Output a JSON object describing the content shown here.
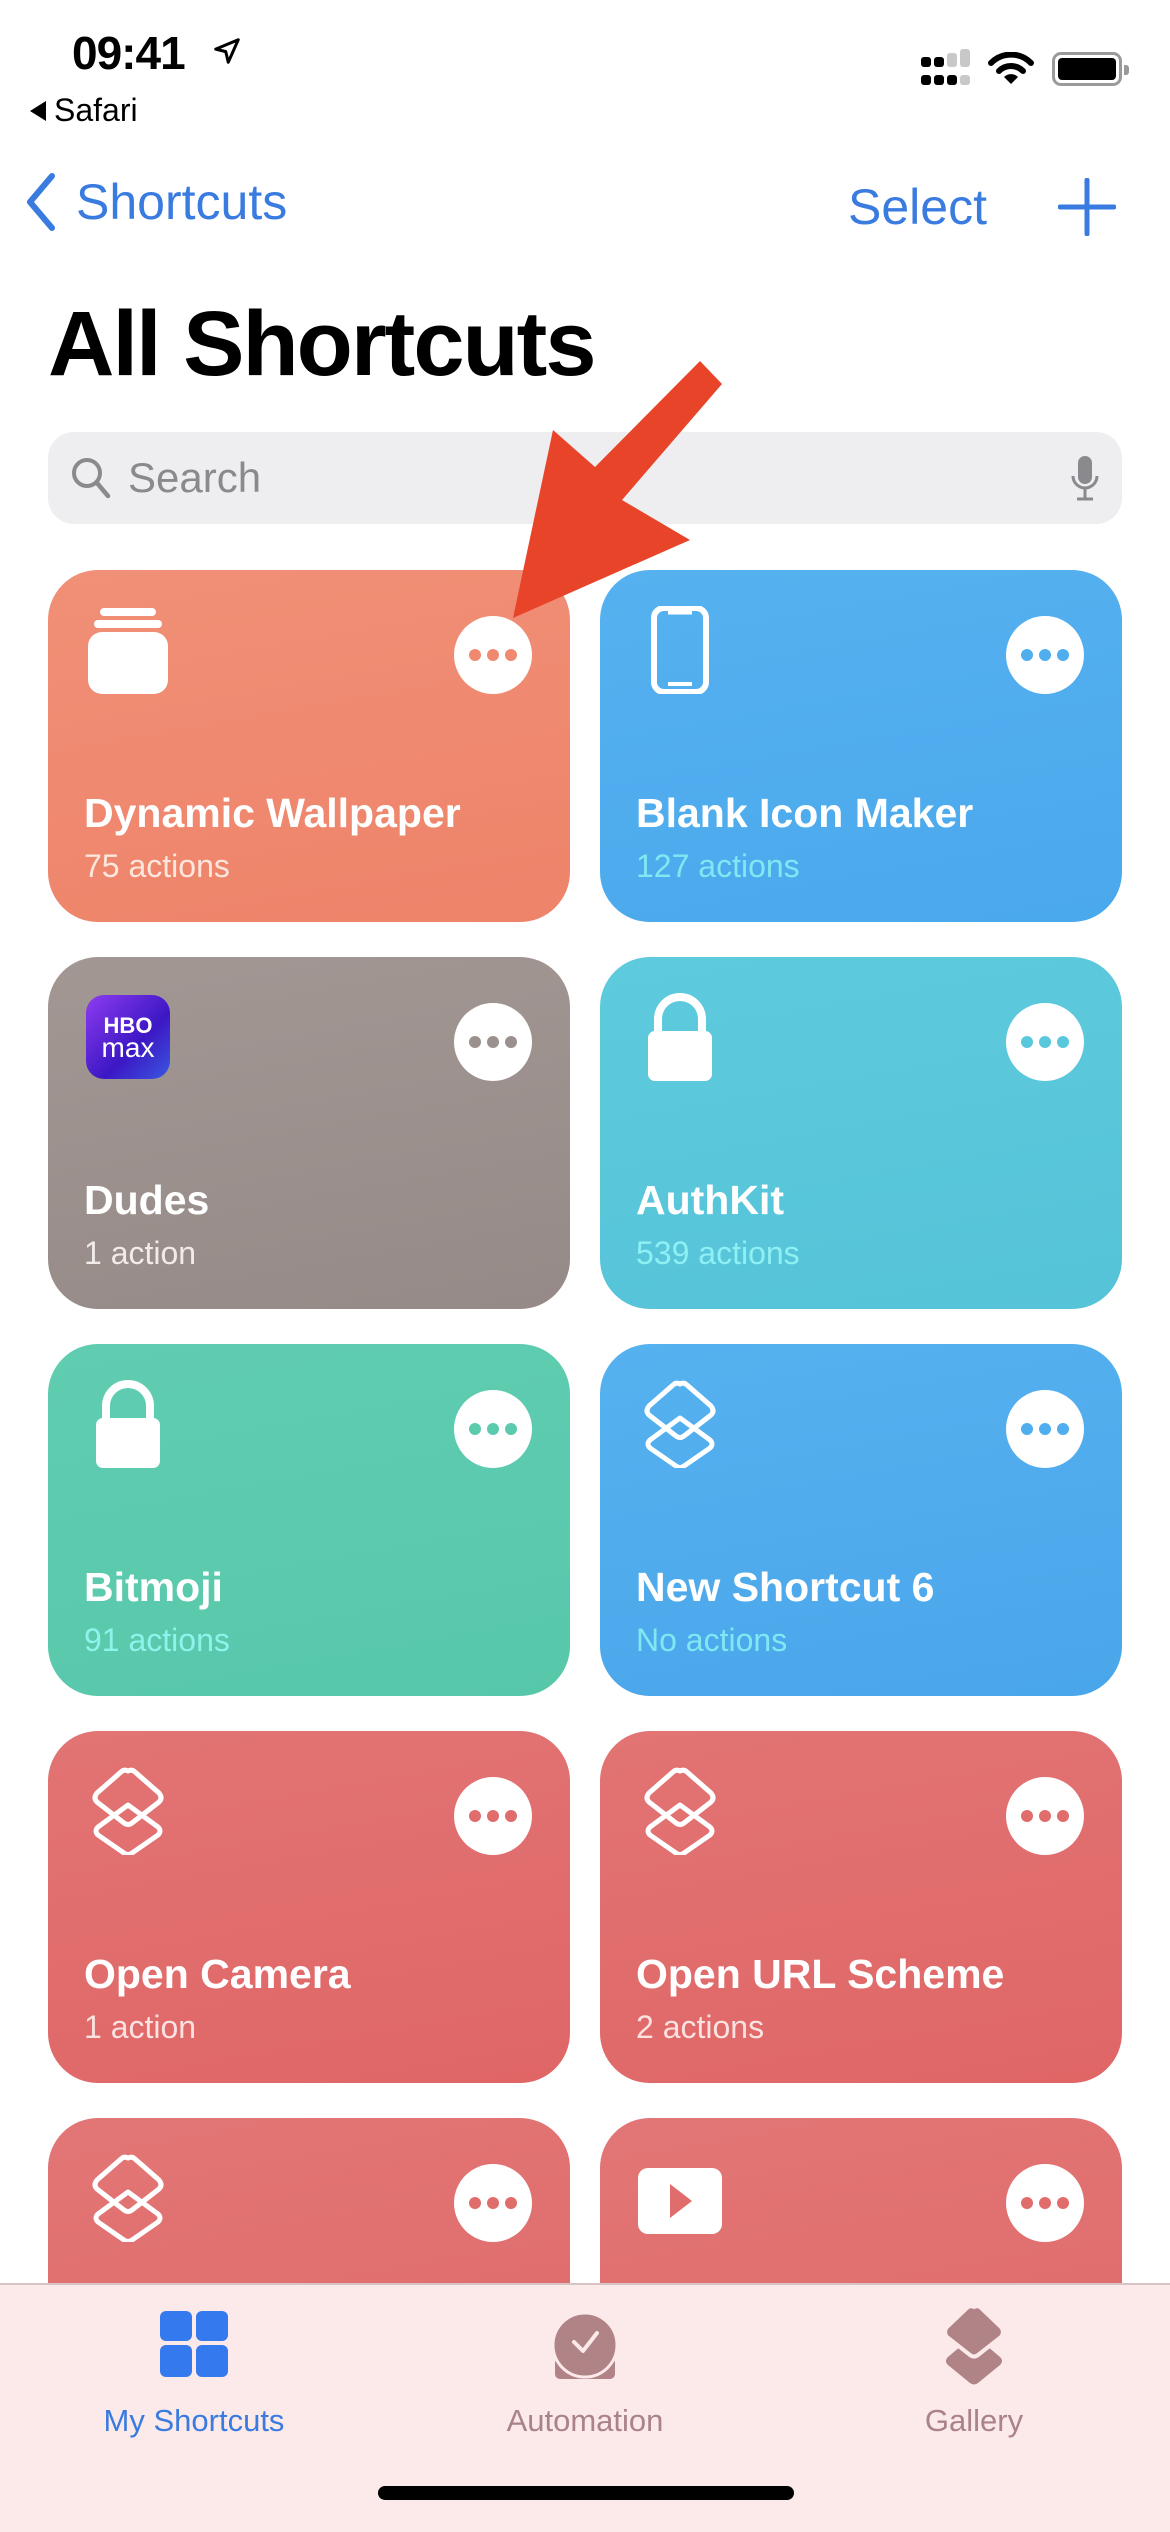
{
  "status_bar": {
    "time": "09:41",
    "back_app": "Safari",
    "icons": [
      "location-arrow-icon",
      "dual-signal-icon",
      "wifi-icon",
      "battery-icon"
    ]
  },
  "nav": {
    "back_label": "Shortcuts",
    "select_label": "Select",
    "add_icon": "plus-icon"
  },
  "page_title": "All Shortcuts",
  "search": {
    "placeholder": "Search",
    "value": ""
  },
  "colors": {
    "accent": "#3a7be0",
    "annotation_arrow": "#e8442a",
    "tab_inactive": "#a98386"
  },
  "shortcuts": [
    {
      "title": "Dynamic Wallpaper",
      "subtitle": "75 actions",
      "icon": "stack-icon",
      "color_top": "#f09077",
      "color_bottom": "#ee8369",
      "dot_color": "#ef8a70",
      "sub_color": "#fde6dc"
    },
    {
      "title": "Blank Icon Maker",
      "subtitle": "127 actions",
      "icon": "iphone-icon",
      "color_top": "#56b1ef",
      "color_bottom": "#4aa8ec",
      "dot_color": "#50adee",
      "sub_color": "#7fe8f2"
    },
    {
      "title": "Dudes",
      "subtitle": "1 action",
      "icon": "hbo-max-icon",
      "color_top": "#a29793",
      "color_bottom": "#958a87",
      "dot_color": "#9a908d",
      "sub_color": "#f1ecea"
    },
    {
      "title": "AuthKit",
      "subtitle": "539 actions",
      "icon": "lock-icon",
      "color_top": "#5ecadd",
      "color_bottom": "#55c3d8",
      "dot_color": "#5ac8dc",
      "sub_color": "#8ff0f4"
    },
    {
      "title": "Bitmoji",
      "subtitle": "91 actions",
      "icon": "lock-icon",
      "color_top": "#60cdb1",
      "color_bottom": "#57c7aa",
      "dot_color": "#5ccaad",
      "sub_color": "#8ff3ec"
    },
    {
      "title": "New Shortcut 6",
      "subtitle": "No actions",
      "icon": "shortcuts-layers-icon",
      "color_top": "#56b1ef",
      "color_bottom": "#4aa6ea",
      "dot_color": "#50adee",
      "sub_color": "#7fe8f2"
    },
    {
      "title": "Open Camera",
      "subtitle": "1 action",
      "icon": "shortcuts-layers-icon",
      "color_top": "#e27474",
      "color_bottom": "#e06666",
      "dot_color": "#e06c6c",
      "sub_color": "#fbe2e0"
    },
    {
      "title": "Open URL Scheme",
      "subtitle": "2 actions",
      "icon": "shortcuts-layers-icon",
      "color_top": "#e27474",
      "color_bottom": "#e06666",
      "dot_color": "#e06c6c",
      "sub_color": "#fbe2e0"
    },
    {
      "title": "",
      "subtitle": "",
      "icon": "shortcuts-layers-icon",
      "color_top": "#e27676",
      "color_bottom": "#e06868",
      "dot_color": "#e06c6c",
      "sub_color": "#fbe2e0"
    },
    {
      "title": "",
      "subtitle": "",
      "icon": "play-icon",
      "color_top": "#e27676",
      "color_bottom": "#e06868",
      "dot_color": "#e06c6c",
      "sub_color": "#fbe2e0"
    }
  ],
  "tabs": [
    {
      "label": "My Shortcuts",
      "icon": "grid-icon",
      "active": true
    },
    {
      "label": "Automation",
      "icon": "clock-check-icon",
      "active": false
    },
    {
      "label": "Gallery",
      "icon": "layers-icon",
      "active": false
    }
  ]
}
